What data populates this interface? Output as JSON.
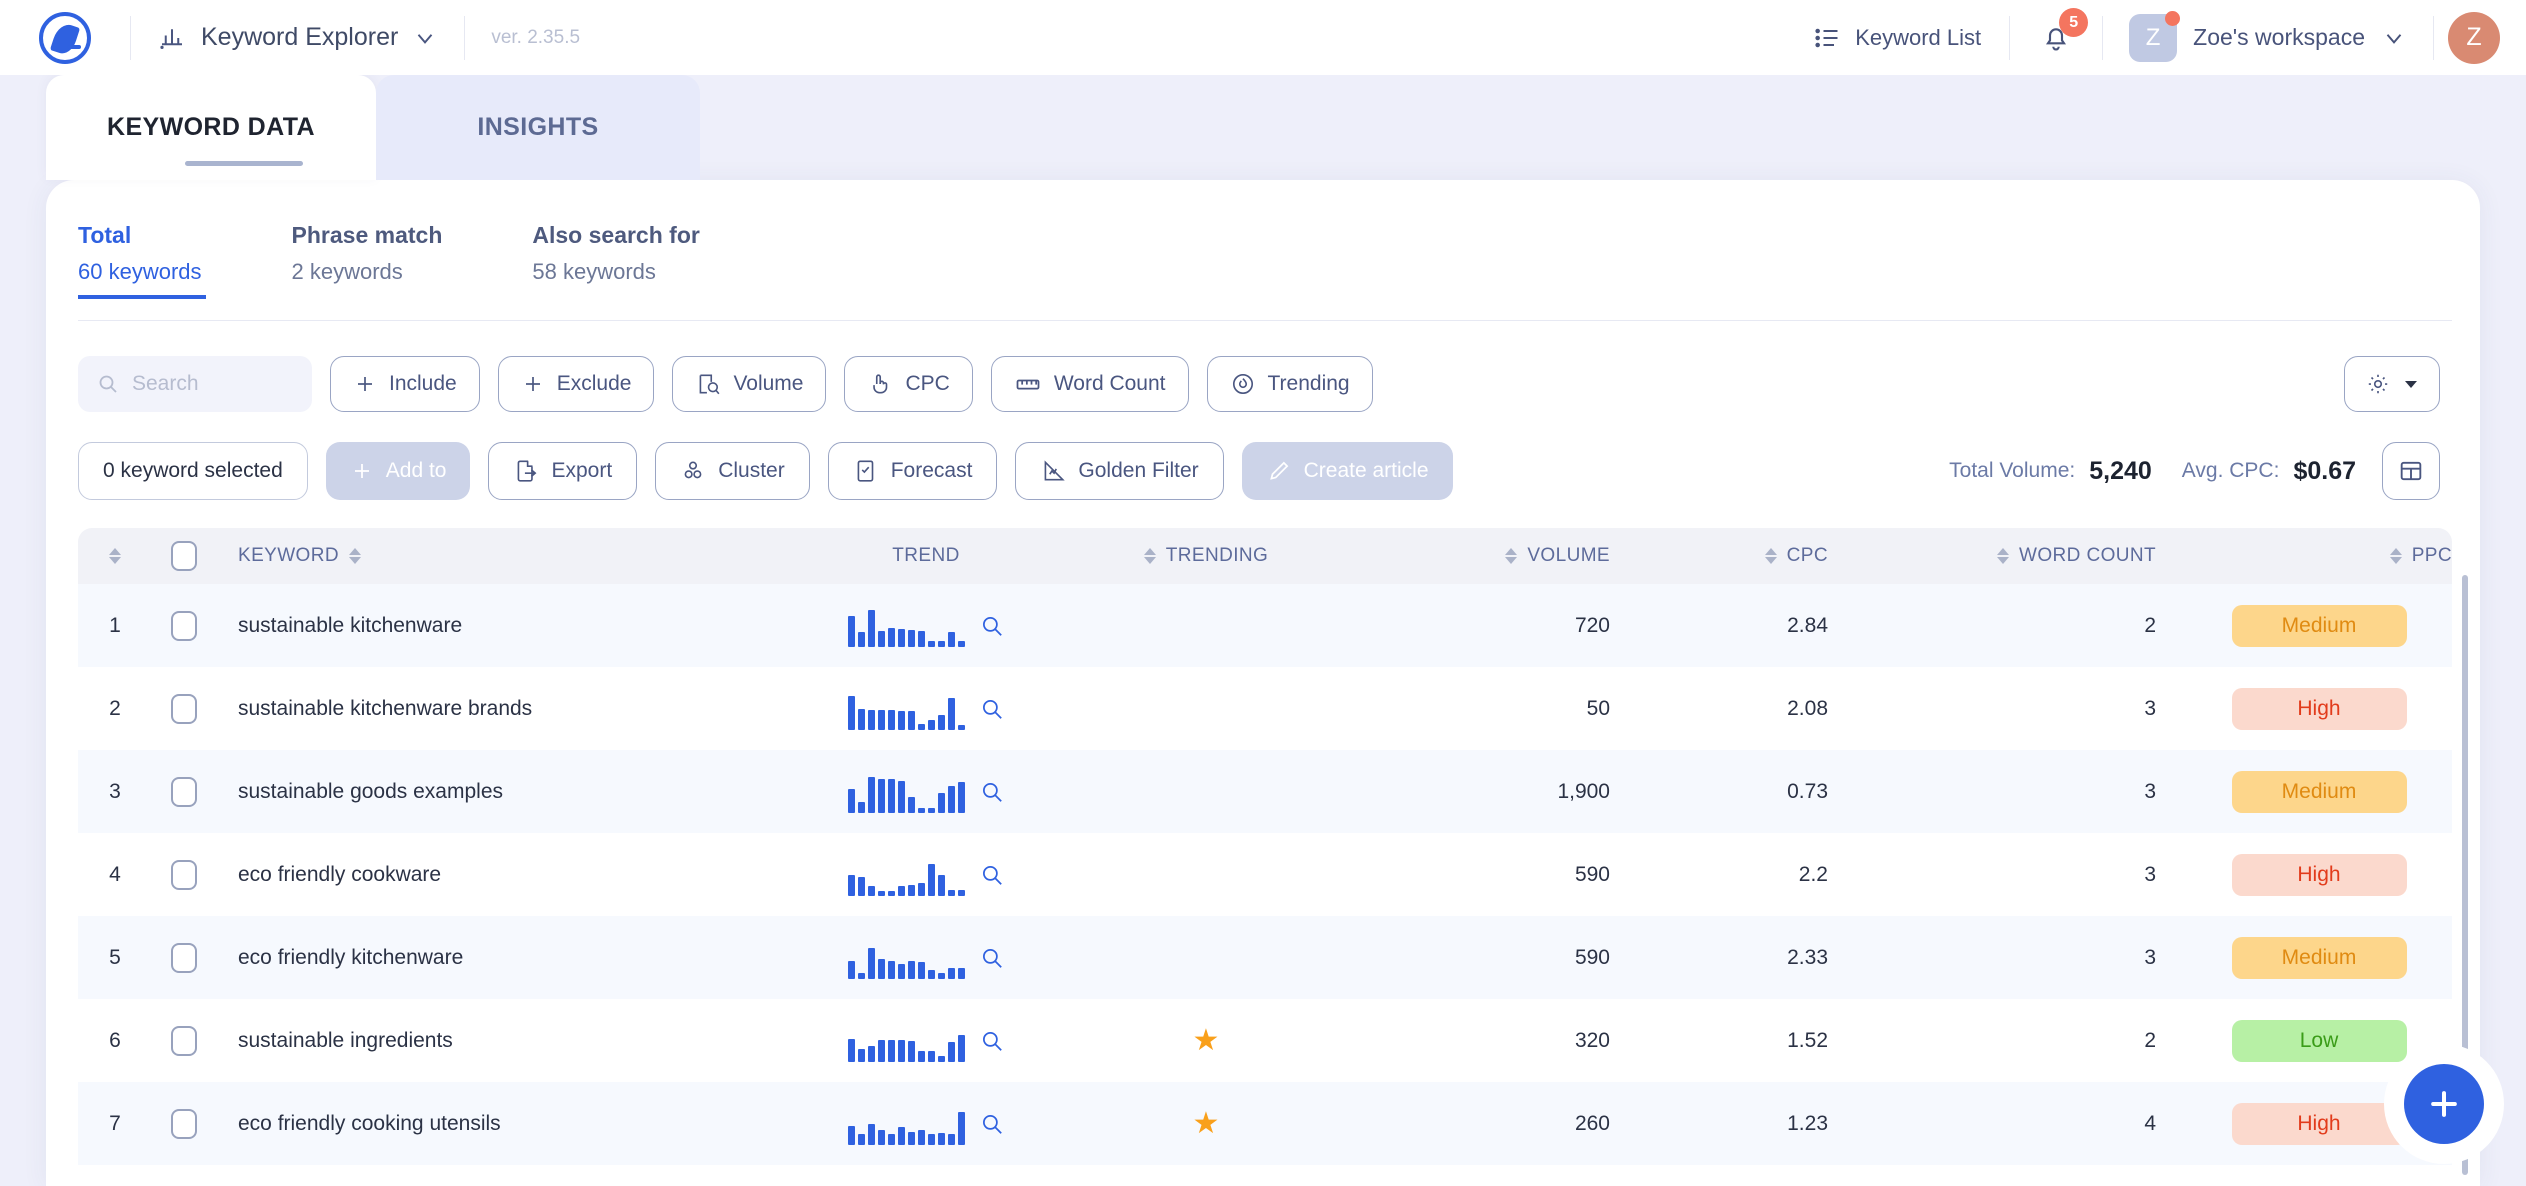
{
  "topbar": {
    "app_name": "Keyword Explorer",
    "version": "ver. 2.35.5",
    "keyword_list_label": "Keyword List",
    "notification_count": "5",
    "workspace_initial": "Z",
    "workspace_name": "Zoe's workspace",
    "avatar_initial": "Z"
  },
  "tabs": [
    {
      "label": "KEYWORD DATA",
      "active": true
    },
    {
      "label": "INSIGHTS",
      "active": false
    }
  ],
  "subtabs": [
    {
      "title": "Total",
      "sub": "60 keywords",
      "active": true
    },
    {
      "title": "Phrase match",
      "sub": "2 keywords",
      "active": false
    },
    {
      "title": "Also search for",
      "sub": "58 keywords",
      "active": false
    }
  ],
  "search": {
    "placeholder": "Search"
  },
  "filter_buttons": [
    {
      "label": "Include",
      "icon": "plus-icon"
    },
    {
      "label": "Exclude",
      "icon": "plus-icon"
    },
    {
      "label": "Volume",
      "icon": "volume-filter-icon"
    },
    {
      "label": "CPC",
      "icon": "cpc-hand-icon"
    },
    {
      "label": "Word Count",
      "icon": "ruler-icon"
    },
    {
      "label": "Trending",
      "icon": "flame-icon"
    }
  ],
  "settings_button": {
    "icon": "gear-icon",
    "caret": "chevron-down-icon"
  },
  "action_buttons": [
    {
      "label": "0 keyword selected",
      "style": "plain",
      "icon": ""
    },
    {
      "label": "Add to",
      "style": "disabled",
      "icon": "plus-icon"
    },
    {
      "label": "Export",
      "style": "normal",
      "icon": "export-icon"
    },
    {
      "label": "Cluster",
      "style": "normal",
      "icon": "cluster-icon"
    },
    {
      "label": "Forecast",
      "style": "normal",
      "icon": "forecast-icon"
    },
    {
      "label": "Golden Filter",
      "style": "normal",
      "icon": "golden-filter-icon"
    },
    {
      "label": "Create article",
      "style": "disabled",
      "icon": "pencil-icon"
    }
  ],
  "stats": {
    "total_volume_label": "Total Volume:",
    "total_volume_value": "5,240",
    "avg_cpc_label": "Avg. CPC:",
    "avg_cpc_value": "$0.67"
  },
  "layout_button": {
    "icon": "table-layout-icon"
  },
  "table": {
    "columns": [
      "KEYWORD",
      "TREND",
      "TRENDING",
      "VOLUME",
      "CPC",
      "WORD COUNT",
      "PPC"
    ],
    "rows": [
      {
        "index": "1",
        "keyword": "sustainable kitchenware",
        "trend": [
          72,
          34,
          86,
          38,
          44,
          42,
          40,
          36,
          12,
          12,
          34,
          14
        ],
        "trending": false,
        "volume": "720",
        "cpc": "2.84",
        "word_count": "2",
        "ppc": "Medium"
      },
      {
        "index": "2",
        "keyword": "sustainable kitchenware brands",
        "trend": [
          80,
          48,
          46,
          46,
          46,
          44,
          44,
          14,
          22,
          34,
          74,
          10
        ],
        "trending": false,
        "volume": "50",
        "cpc": "2.08",
        "word_count": "3",
        "ppc": "High"
      },
      {
        "index": "3",
        "keyword": "sustainable goods examples",
        "trend": [
          56,
          26,
          84,
          80,
          80,
          76,
          38,
          10,
          10,
          46,
          62,
          72
        ],
        "trending": false,
        "volume": "1,900",
        "cpc": "0.73",
        "word_count": "3",
        "ppc": "Medium"
      },
      {
        "index": "4",
        "keyword": "eco friendly cookware",
        "trend": [
          50,
          44,
          22,
          10,
          10,
          22,
          26,
          30,
          76,
          50,
          12,
          12
        ],
        "trending": false,
        "volume": "590",
        "cpc": "2.2",
        "word_count": "3",
        "ppc": "High"
      },
      {
        "index": "5",
        "keyword": "eco friendly kitchenware",
        "trend": [
          42,
          14,
          72,
          46,
          42,
          34,
          42,
          40,
          20,
          14,
          24,
          24
        ],
        "trending": false,
        "volume": "590",
        "cpc": "2.33",
        "word_count": "3",
        "ppc": "Medium"
      },
      {
        "index": "6",
        "keyword": "sustainable ingredients",
        "trend": [
          54,
          30,
          36,
          52,
          52,
          52,
          50,
          26,
          24,
          14,
          46,
          62
        ],
        "trending": true,
        "volume": "320",
        "cpc": "1.52",
        "word_count": "2",
        "ppc": "Low"
      },
      {
        "index": "7",
        "keyword": "eco friendly cooking utensils",
        "trend": [
          44,
          24,
          48,
          34,
          26,
          42,
          30,
          34,
          24,
          28,
          26,
          78
        ],
        "trending": true,
        "volume": "260",
        "cpc": "1.23",
        "word_count": "4",
        "ppc": "High"
      }
    ]
  },
  "fab": {
    "icon": "plus-icon"
  },
  "colors": {
    "accent": "#2f61e0",
    "badge": "#f4755f",
    "pill_medium_bg": "#fdd68b",
    "pill_medium_fg": "#e08b12",
    "pill_high_bg": "#fbd9cd",
    "pill_high_fg": "#e23b1b",
    "pill_low_bg": "#b7f0a5",
    "pill_low_fg": "#3a9c18",
    "star": "#f9a01b"
  }
}
